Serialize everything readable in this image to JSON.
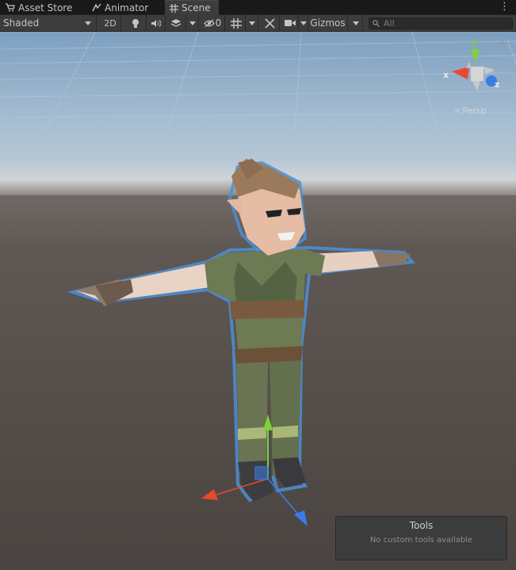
{
  "tabs": [
    {
      "label": "Asset Store",
      "icon": "shopping-cart-icon"
    },
    {
      "label": "Animator",
      "icon": "animator-icon"
    },
    {
      "label": "Scene",
      "icon": "grid-hash-icon",
      "active": true
    }
  ],
  "toolbar": {
    "draw_mode": "Shaded",
    "mode_2d": "2D",
    "hidden_count": "0",
    "gizmos_label": "Gizmos",
    "search_placeholder": "All"
  },
  "orientation_gizmo": {
    "y_label": "y",
    "x_label": "x",
    "z_label": "z",
    "projection": "Persp"
  },
  "tools_overlay": {
    "title": "Tools",
    "subtitle": "No custom tools available"
  },
  "colors": {
    "axis_x": "#e64a2e",
    "axis_y": "#7fd03a",
    "axis_z": "#3a7be8",
    "selection_outline": "#4a8fd8"
  }
}
